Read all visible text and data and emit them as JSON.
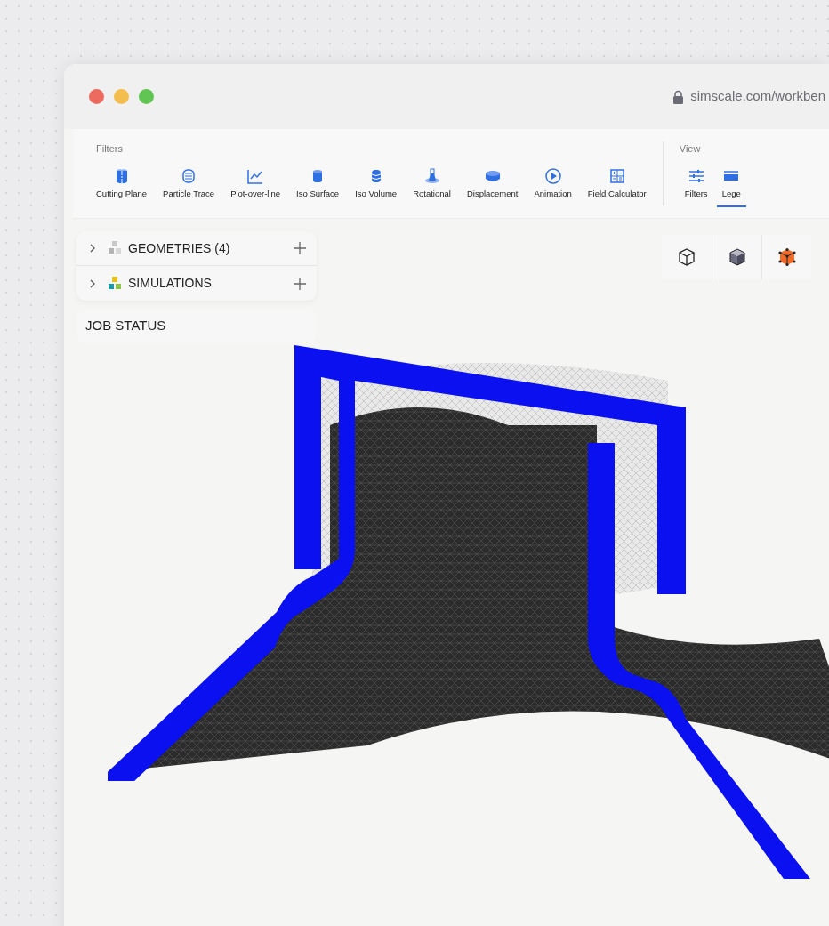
{
  "window": {
    "url": "simscale.com/workben"
  },
  "toolbar": {
    "filters": {
      "title": "Filters",
      "items": [
        {
          "kind": "cutting-plane",
          "label": "Cutting Plane"
        },
        {
          "kind": "particle-trace",
          "label": "Particle Trace"
        },
        {
          "kind": "plot",
          "label": "Plot-over-line"
        },
        {
          "kind": "iso-surface",
          "label": "Iso Surface"
        },
        {
          "kind": "iso-volume",
          "label": "Iso Volume"
        },
        {
          "kind": "rotational",
          "label": "Rotational"
        },
        {
          "kind": "displacement",
          "label": "Displacement"
        },
        {
          "kind": "animation",
          "label": "Animation"
        },
        {
          "kind": "calculator",
          "label": "Field Calculator"
        }
      ]
    },
    "view": {
      "title": "View",
      "items": [
        {
          "kind": "sliders",
          "label": "Filters",
          "selected": false
        },
        {
          "kind": "legend",
          "label": "Lege",
          "selected": true
        }
      ]
    }
  },
  "tree": {
    "items": [
      {
        "kind": "geometry",
        "label": "GEOMETRIES (4)",
        "expanded": false
      },
      {
        "kind": "simulation",
        "label": "SIMULATIONS",
        "expanded": false
      }
    ],
    "job_status": "JOB STATUS"
  },
  "view_cube": [
    {
      "kind": "wireframe"
    },
    {
      "kind": "solid"
    },
    {
      "kind": "vertices"
    }
  ]
}
